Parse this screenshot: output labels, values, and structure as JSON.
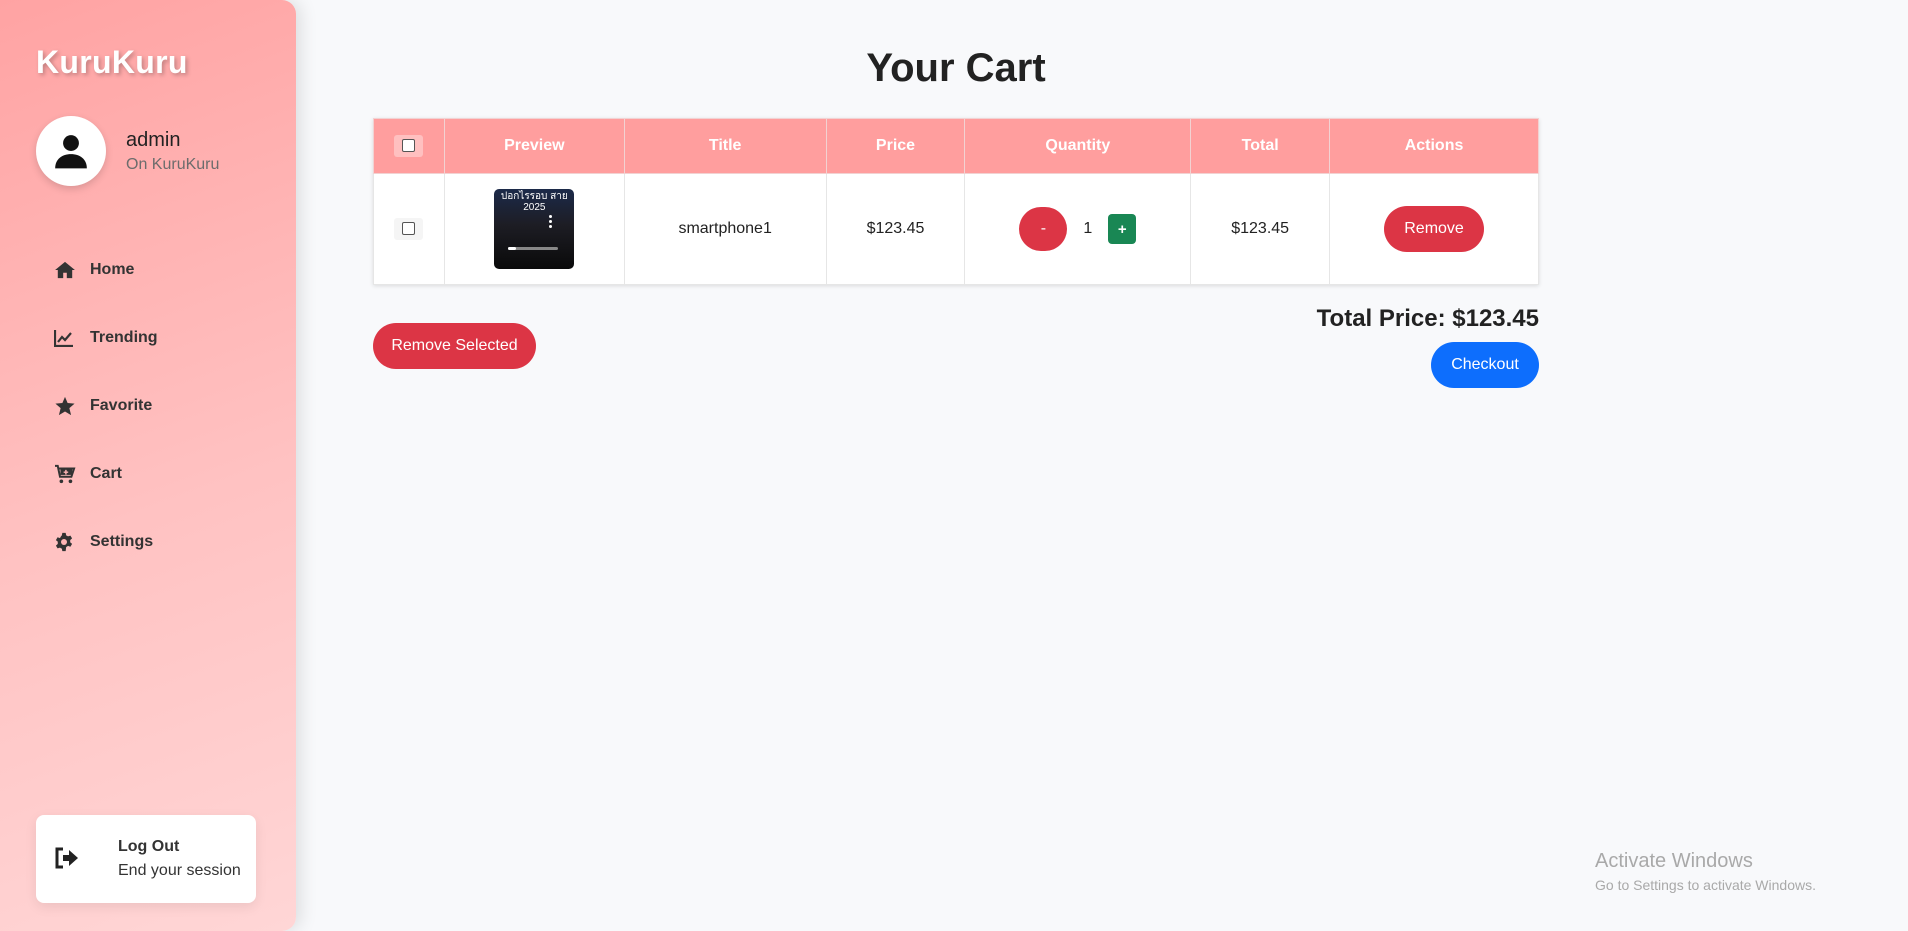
{
  "brand": "KuruKuru",
  "profile": {
    "name": "admin",
    "subtitle": "On KuruKuru"
  },
  "nav": [
    {
      "label": "Home",
      "icon": "home-icon"
    },
    {
      "label": "Trending",
      "icon": "chart-line-icon"
    },
    {
      "label": "Favorite",
      "icon": "star-icon"
    },
    {
      "label": "Cart",
      "icon": "cart-icon"
    },
    {
      "label": "Settings",
      "icon": "gear-icon"
    }
  ],
  "logout": {
    "title": "Log Out",
    "subtitle": "End your session",
    "icon": "sign-out-icon"
  },
  "page": {
    "title": "Your Cart"
  },
  "table": {
    "headers": [
      "Preview",
      "Title",
      "Price",
      "Quantity",
      "Total",
      "Actions"
    ],
    "rows": [
      {
        "thumb_text": "ปอกไรรอบ สาย 2025",
        "title": "smartphone1",
        "price": "$123.45",
        "quantity": "1",
        "total": "$123.45",
        "minus_label": "-",
        "plus_label": "+",
        "remove_label": "Remove"
      }
    ]
  },
  "actions": {
    "remove_selected_label": "Remove Selected",
    "total_price": "Total Price: $123.45",
    "checkout_label": "Checkout"
  },
  "watermark": {
    "title": "Activate Windows",
    "subtitle": "Go to Settings to activate Windows."
  },
  "colors": {
    "sidebar": "#ffa3a3",
    "table_header": "#ff9e9e",
    "danger": "#dc3545",
    "success": "#198754",
    "primary": "#0d6efd"
  }
}
